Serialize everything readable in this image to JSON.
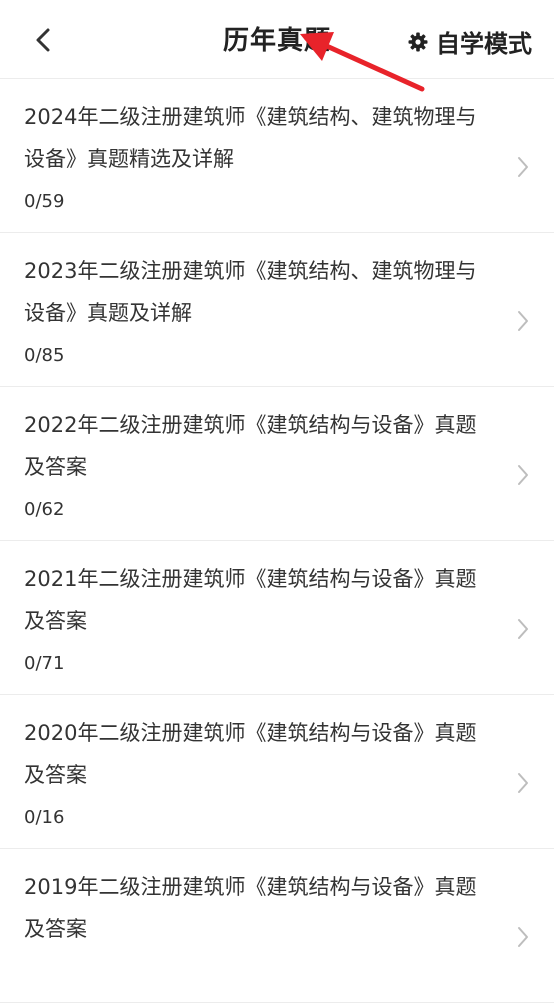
{
  "header": {
    "title": "历年真题",
    "mode_label": "自学模式",
    "back_icon": "chevron-left-icon",
    "mode_icon": "gear-icon",
    "annotation_color": "#e8232a"
  },
  "items": [
    {
      "title": "2024年二级注册建筑师《建筑结构、建筑物理与设备》真题精选及详解",
      "count": "0/59"
    },
    {
      "title": "2023年二级注册建筑师《建筑结构、建筑物理与设备》真题及详解",
      "count": "0/85"
    },
    {
      "title": "2022年二级注册建筑师《建筑结构与设备》真题及答案",
      "count": "0/62"
    },
    {
      "title": "2021年二级注册建筑师《建筑结构与设备》真题及答案",
      "count": "0/71"
    },
    {
      "title": "2020年二级注册建筑师《建筑结构与设备》真题及答案",
      "count": "0/16"
    },
    {
      "title": "2019年二级注册建筑师《建筑结构与设备》真题及答案",
      "count": ""
    }
  ]
}
